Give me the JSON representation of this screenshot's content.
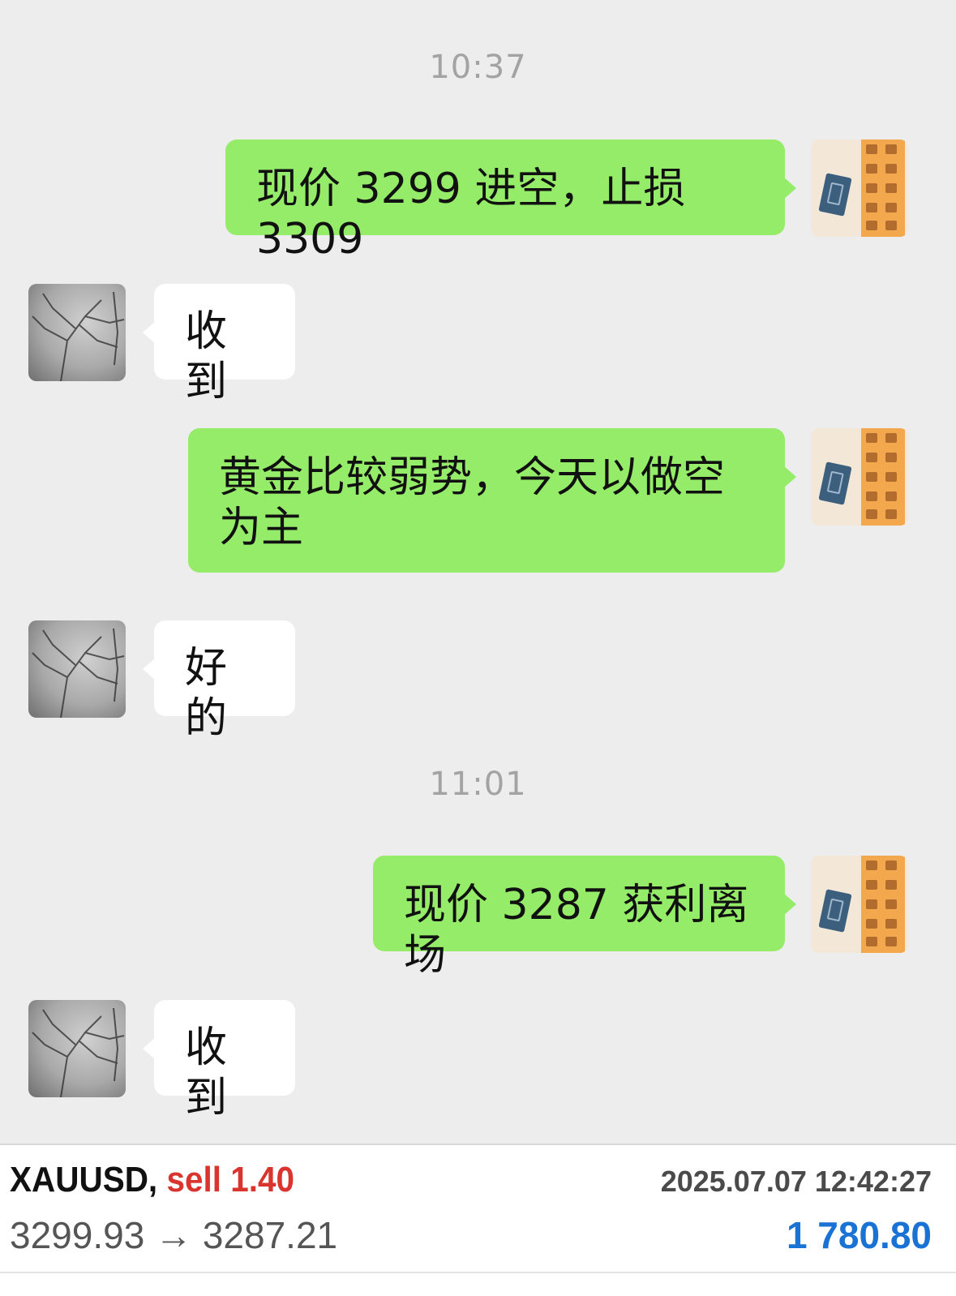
{
  "chat": {
    "timestamps": [
      "10:37",
      "11:01"
    ],
    "messages": [
      {
        "side": "out",
        "text": "现价 3299 进空，止损 3309"
      },
      {
        "side": "in",
        "text": "收到"
      },
      {
        "side": "out",
        "text": "黄金比较弱势，今天以做空为主"
      },
      {
        "side": "in",
        "text": "好的"
      },
      {
        "side": "out",
        "text": "现价 3287 获利离场"
      },
      {
        "side": "in",
        "text": "收到"
      }
    ],
    "colors": {
      "outgoing_bubble": "#95ec69",
      "incoming_bubble": "#ffffff",
      "background": "#ededed"
    },
    "avatars": {
      "self": "calligraphy-avatar",
      "other": "tree-avatar"
    }
  },
  "trade": {
    "symbol": "XAUUSD,",
    "side": "sell",
    "lots": "1.40",
    "datetime": "2025.07.07 12:42:27",
    "open_price": "3299.93",
    "arrow": "→",
    "close_price": "3287.21",
    "profit": "1 780.80",
    "colors": {
      "sell": "#d9352e",
      "profit": "#1a73d4"
    }
  }
}
